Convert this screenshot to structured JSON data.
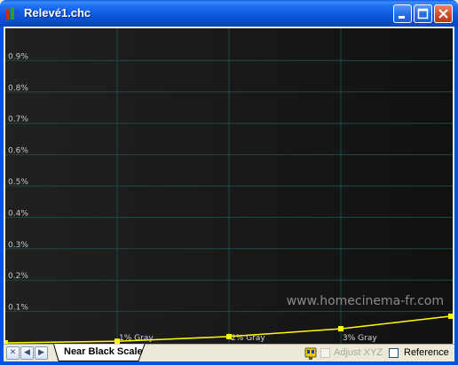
{
  "window": {
    "title": "Relevé1.chc"
  },
  "icons": {
    "app": "bar-chart-icon",
    "minimize": "minimize-icon",
    "maximize": "maximize-icon",
    "close": "close-icon",
    "status": "probe-icon"
  },
  "colors": {
    "series_line": "#ffff00",
    "grid": "#1f4a4a",
    "background": "#1a1a1a"
  },
  "chart_data": {
    "type": "line",
    "categories": [
      "",
      "1% Gray",
      "2% Gray",
      "3% Gray",
      ""
    ],
    "series": [
      {
        "values": [
          0.0,
          0.005,
          0.02,
          0.045,
          0.085
        ]
      }
    ],
    "ylim": [
      0,
      1.0
    ],
    "yticks": [
      "0.1%",
      "0.2%",
      "0.3%",
      "0.4%",
      "0.5%",
      "0.6%",
      "0.7%",
      "0.8%",
      "0.9%"
    ],
    "grid": true,
    "watermark": "www.homecinema-fr.com"
  },
  "statusbar": {
    "nav": [
      "✕",
      "◀",
      "▶"
    ],
    "tab_label": "Near Black Scale",
    "adjust_label": "Adjust XYZ",
    "reference_label": "Reference"
  }
}
